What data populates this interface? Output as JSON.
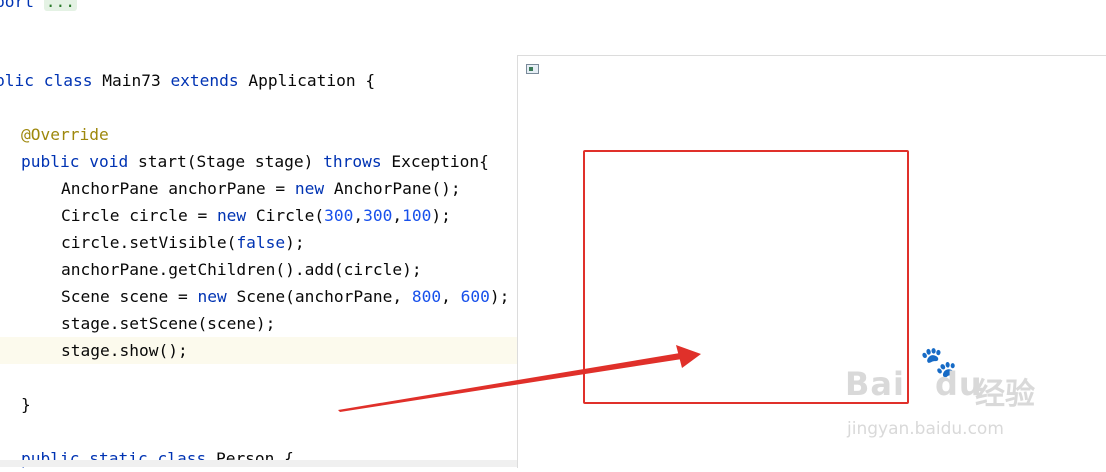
{
  "code": {
    "fold_prefix": "port ",
    "fold_text": "...",
    "class_prefix": "blic ",
    "class_kw": "class",
    "class_name": " Main73 ",
    "extends_kw": "extends",
    "class_rest": " Application {",
    "annotation": "@Override",
    "m_public": "public",
    "m_void": "void",
    "m_name": " start(Stage stage) ",
    "m_throws": "throws",
    "m_rest": " Exception{",
    "l1_a": "AnchorPane anchorPane = ",
    "l1_new": "new",
    "l1_b": " AnchorPane();",
    "l2_a": "Circle circle = ",
    "l2_new": "new",
    "l2_b": " Circle(",
    "l2_n1": "300",
    "l2_n2": "300",
    "l2_n3": "100",
    "l2_c": ");",
    "l3_a": "circle.setVisible(",
    "l3_false": "false",
    "l3_b": ");",
    "l4": "anchorPane.getChildren().add(circle);",
    "l5_a": "Scene scene = ",
    "l5_new": "new",
    "l5_b": " Scene(anchorPane, ",
    "l5_n1": "800",
    "l5_n2": "600",
    "l5_c": ");",
    "l6": "stage.setScene(scene);",
    "l7": "stage.show();",
    "close_brace": "}",
    "p_public": "public",
    "p_static": "static",
    "p_class": "class",
    "p_rest": " Person {"
  },
  "watermark": {
    "logo": "Bai",
    "logo_du": "du",
    "cn": "经验",
    "url": "jingyan.baidu.com"
  },
  "colors": {
    "keyword": "#0033b3",
    "number": "#1750eb",
    "annotation": "#9e880d",
    "highlight": "#e0302a"
  }
}
